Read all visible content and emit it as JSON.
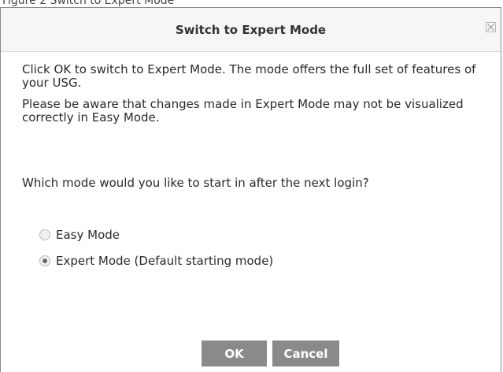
{
  "caption": "Figure 2 Switch to Expert Mode",
  "dialog": {
    "title": "Switch to Expert Mode",
    "close_icon": "close-x-icon",
    "paragraphs": [
      "Click OK to switch to Expert Mode. The mode offers the full set of features of your USG.",
      "Please be aware that changes made in Expert Mode may not be visualized correctly in Easy Mode."
    ],
    "question": "Which mode would you like to start in after the next login?",
    "options": [
      {
        "label": "Easy Mode",
        "selected": false
      },
      {
        "label": "Expert Mode (Default starting mode)",
        "selected": true
      }
    ],
    "buttons": {
      "ok": "OK",
      "cancel": "Cancel"
    }
  },
  "colors": {
    "button_bg": "#8a8a8a",
    "titlebar_bg": "#f6f6f6",
    "border": "#8a8a8a"
  }
}
